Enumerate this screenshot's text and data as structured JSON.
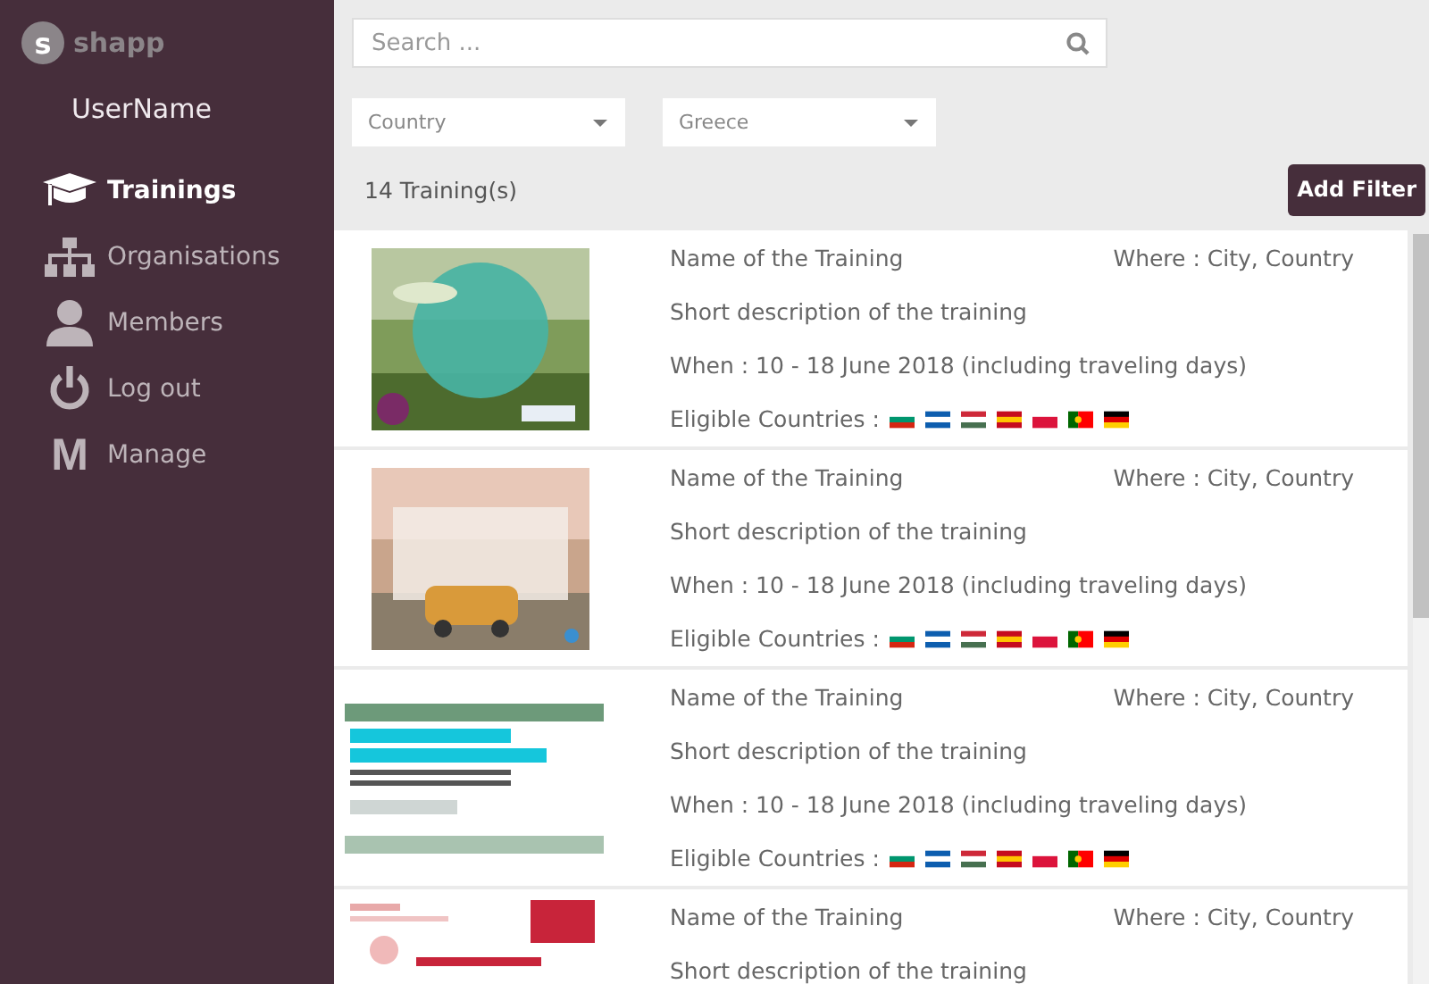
{
  "sidebar": {
    "logo_glyph": "s",
    "logo": "shapp",
    "user": "UserName",
    "items": [
      {
        "label": "Trainings",
        "kind": "cap",
        "selected": true
      },
      {
        "label": "Organisations",
        "kind": "org",
        "selected": false
      },
      {
        "label": "Members",
        "kind": "person",
        "selected": false
      },
      {
        "label": "Log out",
        "kind": "power",
        "selected": false
      },
      {
        "label": "Manage",
        "kind": "letter",
        "glyph": "M",
        "selected": false
      }
    ]
  },
  "search": {
    "placeholder": "Search ..."
  },
  "filters": [
    {
      "value": "Country"
    },
    {
      "value": "Greece"
    }
  ],
  "count": "14 Training(s)",
  "add_filter": "Add Filter",
  "trainings": [
    {
      "name": "Name of the Training",
      "where": "Where : City, Country",
      "description": "Short description of the training",
      "when": "When : 10 - 18 June 2018 (including traveling days)",
      "eligible": "Eligible Countries :"
    },
    {
      "name": "Name of the Training",
      "where": "Where : City, Country",
      "description": "Short description of the training",
      "when": "When : 10 - 18 June 2018 (including traveling days)",
      "eligible": "Eligible Countries :"
    },
    {
      "name": "Name of the Training",
      "where": "Where : City, Country",
      "description": "Short description of the training",
      "when": "When : 10 - 18 June 2018 (including traveling days)",
      "eligible": "Eligible Countries :"
    },
    {
      "name": "Name of the Training",
      "where": "Where : City, Country",
      "description": "Short description of the training"
    }
  ]
}
